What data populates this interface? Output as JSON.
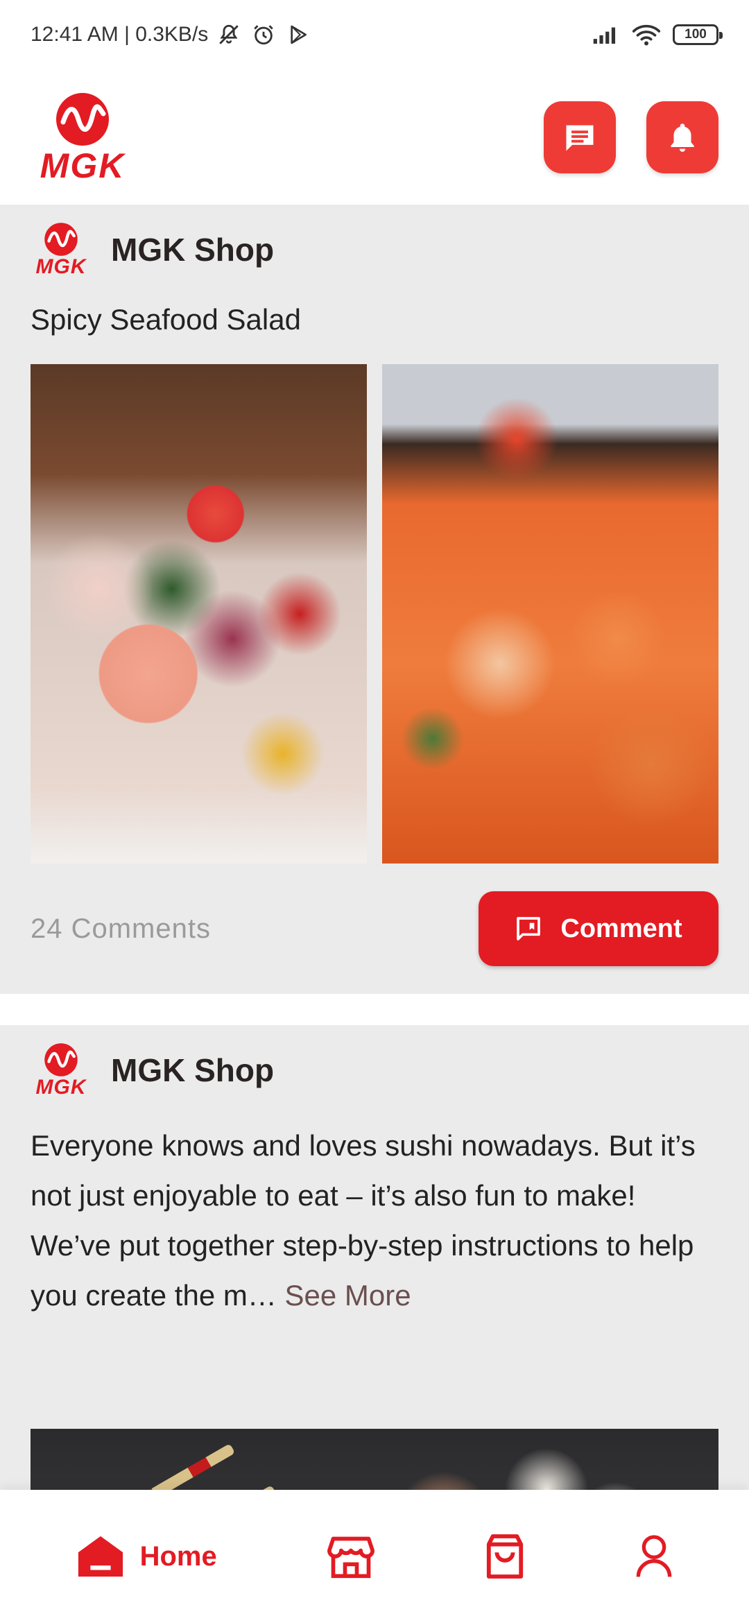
{
  "status_bar": {
    "time_speed": "12:41 AM | 0.3KB/s",
    "battery": "100"
  },
  "header": {
    "logo_text": "MGK",
    "icons": [
      "chat-icon",
      "bell-icon"
    ]
  },
  "colors": {
    "brand_red": "#e31b23",
    "header_button_red": "#ef3b36",
    "feed_bg": "#ebebeb",
    "muted_text": "#9a9a9a"
  },
  "posts": [
    {
      "author": "MGK Shop",
      "logo_text": "MGK",
      "title": "Spicy Seafood Salad",
      "images": [
        "seafood-salad-photo",
        "spicy-shrimp-photo"
      ],
      "comments_count": "24 Comments",
      "comment_button": "Comment"
    },
    {
      "author": "MGK Shop",
      "logo_text": "MGK",
      "body": "Everyone knows and loves sushi nowadays. But it’s not just enjoyable to eat – it’s also fun to make! We’ve put together step-by-step instructions to help you create the m…",
      "see_more": "See More",
      "images": [
        "sushi-photo"
      ]
    }
  ],
  "bottom_nav": {
    "items": [
      {
        "label": "Home",
        "icon": "home-icon",
        "active": true
      },
      {
        "label": "",
        "icon": "store-icon",
        "active": false
      },
      {
        "label": "",
        "icon": "shopping-bag-icon",
        "active": false
      },
      {
        "label": "",
        "icon": "profile-icon",
        "active": false
      }
    ]
  }
}
